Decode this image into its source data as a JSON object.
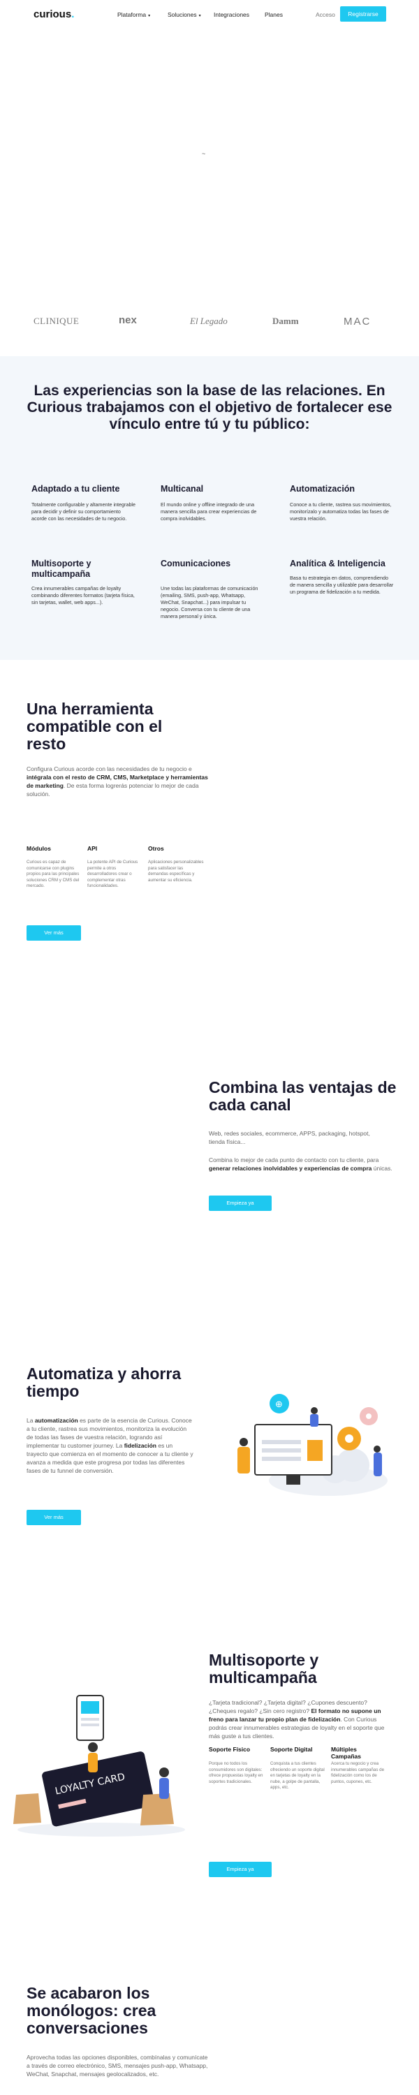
{
  "nav": {
    "logo": "curious",
    "logo_dot": ".",
    "items": [
      {
        "label": "Plataforma",
        "chev": "▾"
      },
      {
        "label": "Soluciones",
        "chev": "▾"
      },
      {
        "label": "Integraciones",
        "chev": ""
      },
      {
        "label": "Planes",
        "chev": ""
      }
    ],
    "login": "Acceso",
    "register": "Registrarse"
  },
  "hero": {
    "loader": "~"
  },
  "brands": [
    "CLINIQUE",
    "nex",
    "El Legado",
    "Damm",
    "MAC"
  ],
  "band": {
    "title": "Las experiencias son la base de las relaciones. En Curious trabajamos con el objetivo de fortalecer ese vínculo entre tú y tu público:",
    "features": [
      {
        "title": "Adaptado a tu cliente",
        "desc": "Totalmente configurable y altamente integrable para decidir y definir su comportamiento acorde con las necesidades de tu negocio."
      },
      {
        "title": "Multicanal",
        "desc": "El mundo online y offline integrado de una manera sencilla para crear experiencias de compra inolvidables."
      },
      {
        "title": "Automatización",
        "desc": "Conoce a tu cliente, rastrea sus movimientos, monitorízalo y automatiza todas las fases de vuestra relación."
      },
      {
        "title": "Multisoporte y multicampaña",
        "desc": "Crea innumerables campañas de loyalty combinando diferentes formatos (tarjeta física, sin tarjetas, wallet, web apps...)."
      },
      {
        "title": "Comunicaciones",
        "desc": "Une todas las plataformas de comunicación (emailing, SMS, push-app, Whatsapp, WeChat, Snapchat...) para impulsar tu negocio. Conversa con tu cliente de una manera personal y única."
      },
      {
        "title": "Analítica & Inteligencia",
        "desc": "Basa tu estrategia en datos, comprendiendo de manera sencilla y utilizable para desarrollar un programa de fidelización a tu medida."
      }
    ]
  },
  "tool": {
    "title": "Una herramienta compatible con el resto",
    "desc_a": "Configura Curious acorde con las necesidades de tu negocio e ",
    "desc_b": "intégrala con el resto de CRM, CMS, Marketplace y herramientas de marketing",
    "desc_c": ". De esta forma logrerás potenciar lo mejor de cada solución.",
    "cols": [
      {
        "title": "Módulos",
        "desc": "Curious es capaz de comunicarse con plugins propios para las principales soluciones CRM y CMS del mercado."
      },
      {
        "title": "API",
        "desc": "La potente API de Curious permite a otros desarrolladores crear o complementar otras funcionalidades."
      },
      {
        "title": "Otros",
        "desc": "Aplicaciones personalizables para satisfacer las demandas específicas y aumentar su eficiencia."
      }
    ],
    "button": "Ver más"
  },
  "channels": {
    "title": "Combina las ventajas de cada canal",
    "p1": "Web, redes sociales, ecommerce, APPS, packaging, hotspot, tienda física...",
    "p2a": "Combina lo mejor de cada punto de contacto con tu cliente, para ",
    "p2b": "generar relaciones inolvidables y experiencias de compra",
    "p2c": " únicas.",
    "button": "Empieza ya"
  },
  "auto": {
    "title": "Automatiza y ahorra tiempo",
    "pa": "La ",
    "pb": "automatización",
    "pc": " es parte de la esencia de Curious. Conoce a tu cliente, rastrea sus movimientos, monitoriza la evolución de todas las fases de vuestra relación, logrando así implementar tu customer journey. La ",
    "pd": "fidelización",
    "pe": " es un trayecto que comienza en el momento de conocer a tu cliente y avanza a medida que este progresa por todas las diferentes fases de tu funnel de conversión.",
    "button": "Ver más"
  },
  "multi": {
    "title": "Multisoporte y multicampaña",
    "pa": "¿Tarjeta tradicional? ¿Tarjeta digital? ¿Cupones descuento? ¿Cheques regalo? ¿Sin cero registro? ",
    "pb": "El formato no supone un freno para lanzar tu propio plan de fidelización",
    "pc": ". Con Curious podrás crear innumerables estrategias de loyalty en el soporte que más guste a tus clientes.",
    "cols": [
      {
        "title": "Soporte Físico",
        "desc": "Porque no todos los consumidores son digitales: ofrece propuestas loyalty en soportes tradicionales."
      },
      {
        "title": "Soporte Digital",
        "desc": "Conquista a tus clientes ofreciendo un soporte digital en tarjetas de loyalty en la nube, a golpe de pantalla, apps, etc."
      },
      {
        "title": "Múltiples Campañas",
        "desc": "Acerca tu negocio y crea innumerables campañas de fidelización como los de puntos, cupones, etc."
      }
    ],
    "card": "LOYALTY CARD",
    "button": "Empieza ya"
  },
  "talk": {
    "title": "Se acabaron los monólogos: crea conversaciones",
    "p": "Aprovecha todas las opciones disponibles, combínalas y comunícate a través de correo electrónico, SMS, mensajes push-app, Whatsapp, WeChat, Snapchat, mensajes geolocalizados, etc."
  },
  "colors": {
    "accent": "#1ec8f0",
    "dark": "#1a1a2e",
    "band": "#f3f7fb"
  }
}
